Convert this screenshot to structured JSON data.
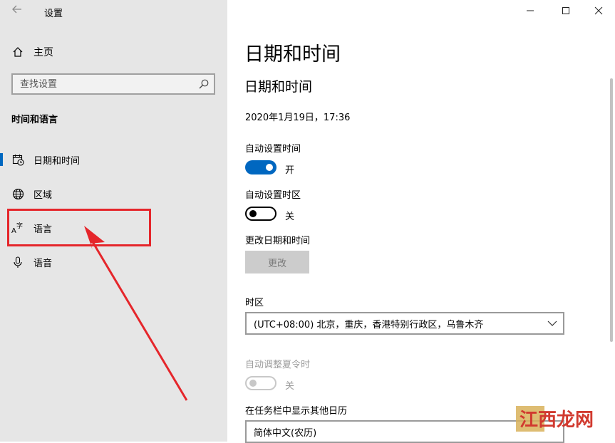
{
  "window": {
    "title": "设置"
  },
  "sidebar": {
    "home": "主页",
    "search_placeholder": "查找设置",
    "section": "时间和语言",
    "items": [
      {
        "label": "日期和时间",
        "icon": "calendar-clock-icon",
        "active": true
      },
      {
        "label": "区域",
        "icon": "globe-icon",
        "active": false
      },
      {
        "label": "语言",
        "icon": "language-icon",
        "active": false
      },
      {
        "label": "语音",
        "icon": "microphone-icon",
        "active": false
      }
    ]
  },
  "main": {
    "page_title": "日期和时间",
    "sub_title": "日期和时间",
    "current_datetime": "2020年1月19日，17:36",
    "auto_time": {
      "label": "自动设置时间",
      "state": "开"
    },
    "auto_timezone": {
      "label": "自动设置时区",
      "state": "关"
    },
    "change_datetime": {
      "label": "更改日期和时间",
      "button": "更改"
    },
    "timezone": {
      "label": "时区",
      "value": "(UTC+08:00) 北京，重庆，香港特别行政区，乌鲁木齐"
    },
    "dst": {
      "label": "自动调整夏令时",
      "state": "关"
    },
    "calendar": {
      "label": "在任务栏中显示其他日历",
      "value": "简体中文(农历)"
    }
  },
  "watermark": "江西龙网",
  "colors": {
    "accent": "#0067c0",
    "highlight": "#e5262b"
  }
}
